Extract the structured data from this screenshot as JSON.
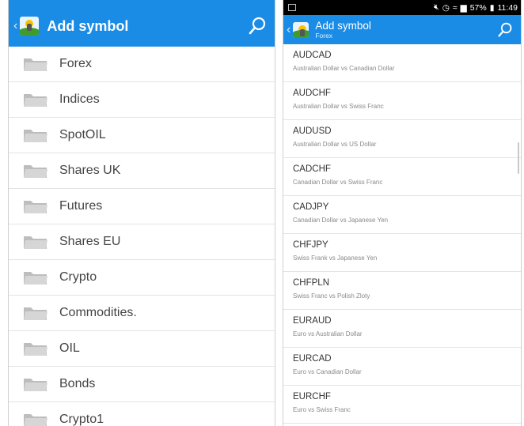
{
  "left": {
    "header": {
      "title": "Add symbol"
    },
    "folders": [
      {
        "label": "Forex"
      },
      {
        "label": "Indices"
      },
      {
        "label": "SpotOIL"
      },
      {
        "label": "Shares UK"
      },
      {
        "label": "Futures"
      },
      {
        "label": "Shares EU"
      },
      {
        "label": "Crypto"
      },
      {
        "label": "Commodities."
      },
      {
        "label": "OIL"
      },
      {
        "label": "Bonds"
      },
      {
        "label": "Crypto1"
      }
    ]
  },
  "right": {
    "status_bar": {
      "battery": "57%",
      "time": "11:49"
    },
    "header": {
      "title": "Add symbol",
      "subtitle": "Forex"
    },
    "symbols": [
      {
        "code": "AUDCAD",
        "description": "Australian Dollar vs Canadian Dollar"
      },
      {
        "code": "AUDCHF",
        "description": "Australian Dollar vs Swiss Franc"
      },
      {
        "code": "AUDUSD",
        "description": "Australian Dollar vs US Dollar"
      },
      {
        "code": "CADCHF",
        "description": "Canadian Dollar vs Swiss Franc"
      },
      {
        "code": "CADJPY",
        "description": "Canadian Dollar vs Japanese Yen"
      },
      {
        "code": "CHFJPY",
        "description": "Swiss Frank vs Japanese Yen"
      },
      {
        "code": "CHFPLN",
        "description": "Swiss Franc vs Polish Zloty"
      },
      {
        "code": "EURAUD",
        "description": "Euro vs Australian Dollar"
      },
      {
        "code": "EURCAD",
        "description": "Euro vs Canadian Dollar"
      },
      {
        "code": "EURCHF",
        "description": "Euro vs Swiss Franc"
      }
    ]
  },
  "colors": {
    "app_bar": "#1a8ce6",
    "folder": "#c7c7c7"
  },
  "icons": {
    "back": "chevron-left-icon",
    "search": "search-icon",
    "folder": "folder-icon",
    "logo": "app-logo-icon"
  }
}
